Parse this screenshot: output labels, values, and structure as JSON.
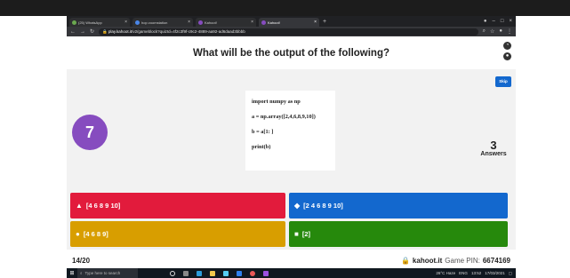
{
  "browser": {
    "tabs": [
      {
        "label": "(25) WhatsApp",
        "active": false
      },
      {
        "label": "hop zoomstation",
        "active": false
      },
      {
        "label": "Kahoot!",
        "active": false
      },
      {
        "label": "Kahoot!",
        "active": true
      }
    ],
    "url_domain": "play.kahoot.it",
    "url_path": "/v2/gameblock?quizId=4f2c3f9f-c9c2-4889-aa92-ad6daad3bbbb"
  },
  "question": {
    "title": "What will be the output of the following?",
    "skip_label": "Skip",
    "timer": "7",
    "code_lines": [
      "import numpy as np",
      "a = np.array([2,4,6,8,9,10])",
      "b = a[1: ]",
      "print(b)"
    ],
    "answers_count": "3",
    "answers_label": "Answers"
  },
  "options": [
    {
      "symbol": "▲",
      "label": "[4 6 8 9 10]",
      "color": "#e21b3c"
    },
    {
      "symbol": "◆",
      "label": "[2 4 6 8 9 10]",
      "color": "#1368ce"
    },
    {
      "symbol": "●",
      "label": "[4 6 8 9]",
      "color": "#d89e00"
    },
    {
      "symbol": "■",
      "label": "[2]",
      "color": "#26890c"
    }
  ],
  "footer": {
    "progress": "14/20",
    "brand": "kahoot.it",
    "pin_label": "Game PIN:",
    "pin": "6674169"
  },
  "taskbar": {
    "search_placeholder": "Type here to search",
    "weather": "26°C Haze",
    "language": "ENG",
    "time": "13:52",
    "date": "17/03/2021"
  }
}
